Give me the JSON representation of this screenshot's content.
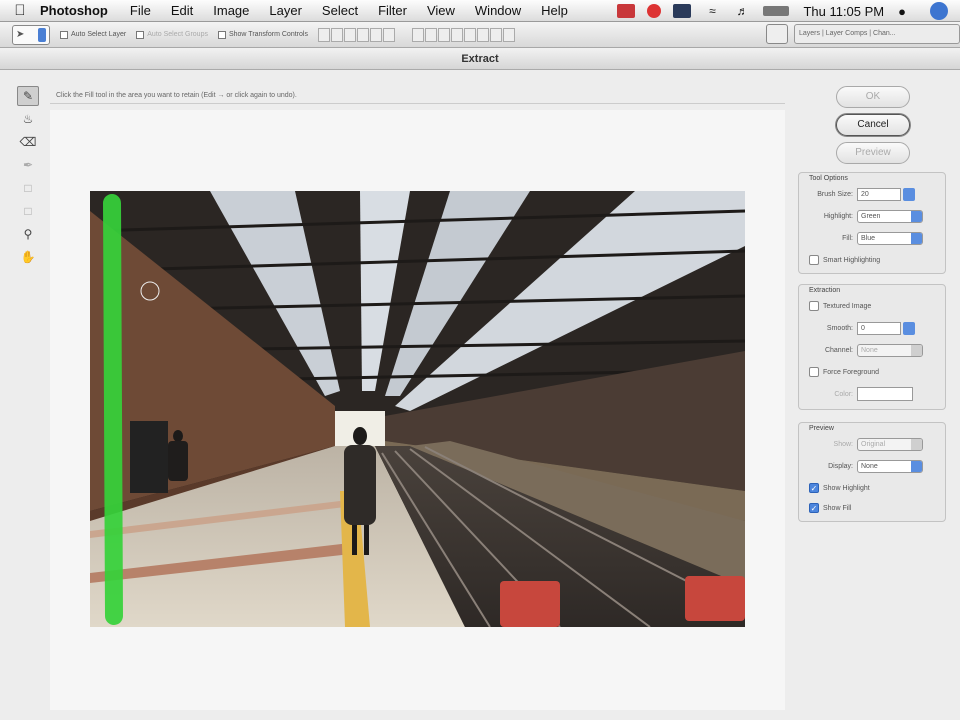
{
  "menubar": {
    "app": "Photoshop",
    "items": [
      "File",
      "Edit",
      "Image",
      "Layer",
      "Select",
      "Filter",
      "View",
      "Window",
      "Help"
    ],
    "clock": "Thu 11:05 PM"
  },
  "options_bar": {
    "auto_select_layer": "Auto Select Layer",
    "auto_select_groups": "Auto Select Groups",
    "show_transform": "Show Transform Controls",
    "palette_well": "Layers | Layer Comps | Chan..."
  },
  "dialog": {
    "title": "Extract",
    "hint": "Click the Fill tool in the area you want to retain (Edit → or click again to undo).",
    "buttons": {
      "ok": "OK",
      "cancel": "Cancel",
      "preview": "Preview"
    },
    "tool_options": {
      "title": "Tool Options",
      "brush_size_label": "Brush Size:",
      "brush_size_value": "20",
      "highlight_label": "Highlight:",
      "highlight_value": "Green",
      "fill_label": "Fill:",
      "fill_value": "Blue",
      "smart_highlighting": "Smart Highlighting"
    },
    "extraction": {
      "title": "Extraction",
      "textured_image": "Textured Image",
      "smooth_label": "Smooth:",
      "smooth_value": "0",
      "channel_label": "Channel:",
      "channel_value": "None",
      "force_foreground": "Force Foreground",
      "color_label": "Color:"
    },
    "preview_group": {
      "title": "Preview",
      "show_label": "Show:",
      "show_value": "Original",
      "display_label": "Display:",
      "display_value": "None",
      "show_highlight": "Show Highlight",
      "show_fill": "Show Fill"
    }
  },
  "colors": {
    "highlight_green": "#36d23a",
    "accent_blue": "#5a8ee0",
    "dialog_bg": "#ededed"
  }
}
